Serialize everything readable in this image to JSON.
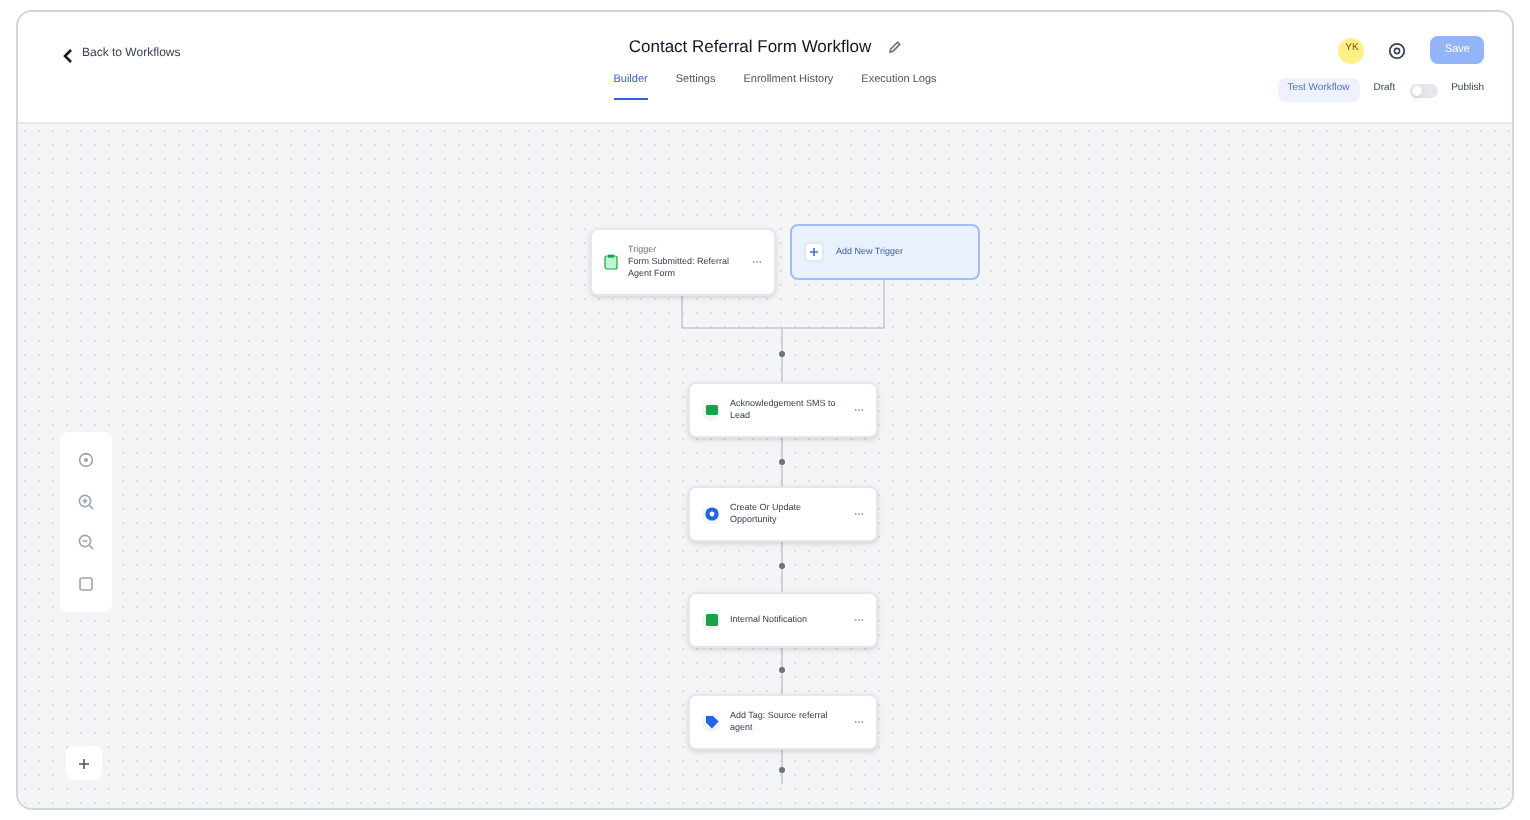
{
  "back_link": "Back to Workflows",
  "title": "Contact Referral Form Workflow",
  "tabs": [
    {
      "label": "Builder",
      "selected": true
    },
    {
      "label": "Settings",
      "selected": false
    },
    {
      "label": "Enrollment History",
      "selected": false
    },
    {
      "label": "Execution Logs",
      "selected": false
    }
  ],
  "avatar": "YK",
  "save_button": "Save",
  "test_button": "Test Workflow",
  "status": {
    "draft_label": "Draft",
    "publish_label": "Publish",
    "on": false
  },
  "trigger": {
    "heading": "Trigger",
    "text": "Form Submitted: Referral Agent Form"
  },
  "add_trigger": "Add New Trigger",
  "steps": [
    {
      "kind": "sms",
      "label": "Acknowledgement SMS to Lead",
      "color": "#16a34a"
    },
    {
      "kind": "opportunity",
      "label": "Create Or Update Opportunity",
      "color": "#2563eb"
    },
    {
      "kind": "notification",
      "label": "Internal Notification",
      "color": "#16a34a"
    },
    {
      "kind": "tag",
      "label": "Add Tag: Source referral agent",
      "color": "#2563eb"
    }
  ]
}
